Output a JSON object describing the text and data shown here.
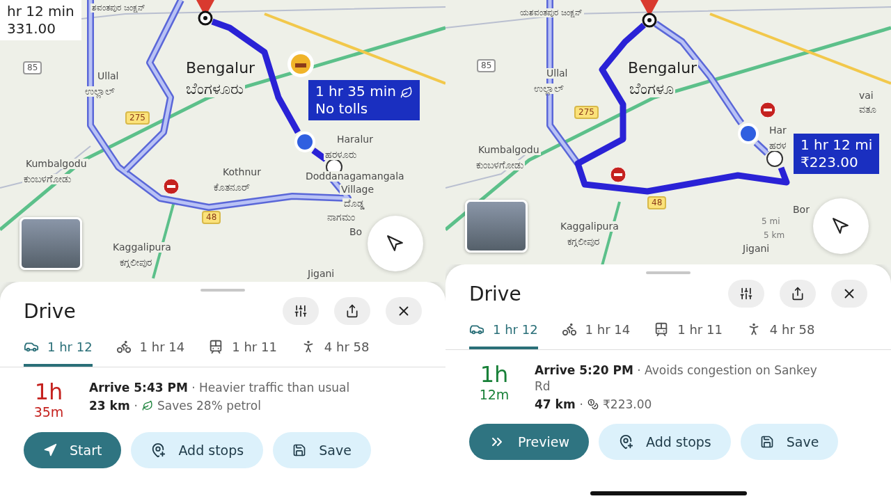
{
  "panels": [
    {
      "map": {
        "labels": [
          {
            "text": "ಶವಂತಪುರ ಜಂಕ್ಷನ್",
            "kind": "small"
          },
          {
            "text": "Bengalur",
            "kind": "city"
          },
          {
            "text": "ಬೆಂಗಳೂರು",
            "kind": "city"
          },
          {
            "text": "Ullal",
            "kind": "place"
          },
          {
            "text": "ಉಲ್ಲಾಲ್",
            "kind": "place"
          },
          {
            "text": "85",
            "kind": "shield-white"
          },
          {
            "text": "275",
            "kind": "shield"
          },
          {
            "text": "48",
            "kind": "shield"
          },
          {
            "text": "Kumbalgodu",
            "kind": "place"
          },
          {
            "text": "ಕುಂಬಳಗೋಡು",
            "kind": "place"
          },
          {
            "text": "Kothnur",
            "kind": "place"
          },
          {
            "text": "ಕೊತನೂರ್",
            "kind": "place"
          },
          {
            "text": "Haralur",
            "kind": "place"
          },
          {
            "text": "ಹರಳೂರು",
            "kind": "place"
          },
          {
            "text": "Doddanagamangala",
            "kind": "place"
          },
          {
            "text": "Village",
            "kind": "place"
          },
          {
            "text": "ದೊಡ್ಡ",
            "kind": "place"
          },
          {
            "text": "ನಾಗಮಂ",
            "kind": "place"
          },
          {
            "text": "Bo",
            "kind": "place"
          },
          {
            "text": "Kaggalipura",
            "kind": "place"
          },
          {
            "text": "ಕಗ್ಗಲೀಪುರ",
            "kind": "place"
          },
          {
            "text": "Jigani",
            "kind": "place"
          }
        ],
        "callouts": [
          {
            "lines": [
              "hr 12 min",
              "331.00"
            ],
            "selected": false,
            "eco": false
          },
          {
            "lines": [
              "1 hr 35 min",
              "No tolls"
            ],
            "selected": true,
            "eco": true
          }
        ]
      },
      "sheet": {
        "title": "Drive",
        "modes": [
          {
            "kind": "car",
            "label": "1 hr 12",
            "selected": true
          },
          {
            "kind": "bike",
            "label": "1 hr 14",
            "selected": false
          },
          {
            "kind": "transit",
            "label": "1 hr 11",
            "selected": false
          },
          {
            "kind": "walk",
            "label": "4 hr 58",
            "selected": false
          }
        ],
        "duration": [
          "1h",
          "35m"
        ],
        "heavy_traffic": true,
        "arrival": "**Arrive 5:43 PM** · Heavier traffic than usual",
        "distance": "23 km",
        "separator": "·",
        "detail": {
          "kind": "eco",
          "text": "Saves 28% petrol"
        },
        "buttons": [
          {
            "kind": "start",
            "label": "Start"
          },
          {
            "kind": "add-stop",
            "label": "Add stops"
          },
          {
            "kind": "save",
            "label": "Save"
          }
        ],
        "home_indicator": false
      }
    },
    {
      "map": {
        "labels": [
          {
            "text": "ಯಶವಂತಪುರ ಜಂಕ್ಷನ್",
            "kind": "small"
          },
          {
            "text": "Bengalur",
            "kind": "city"
          },
          {
            "text": "ಬೆಂಗಳೂ",
            "kind": "city"
          },
          {
            "text": "Ullal",
            "kind": "place"
          },
          {
            "text": "ಉಲ್ಲಾಲ್",
            "kind": "place"
          },
          {
            "text": "85",
            "kind": "shield-white"
          },
          {
            "text": "275",
            "kind": "shield"
          },
          {
            "text": "48",
            "kind": "shield"
          },
          {
            "text": "Kumbalgodu",
            "kind": "place"
          },
          {
            "text": "ಕುಂಬಳಗೋಡು",
            "kind": "place"
          },
          {
            "text": "Har",
            "kind": "place"
          },
          {
            "text": "ಹರಳ",
            "kind": "place"
          },
          {
            "text": "vai",
            "kind": "place"
          },
          {
            "text": "ವತೂ",
            "kind": "place"
          },
          {
            "text": "Bor",
            "kind": "place"
          },
          {
            "text": "5 mi",
            "kind": "scale"
          },
          {
            "text": "5 km",
            "kind": "scale"
          },
          {
            "text": "Kaggalipura",
            "kind": "place"
          },
          {
            "text": "ಕಗ್ಗಲೀಪುರ",
            "kind": "place"
          },
          {
            "text": "Jigani",
            "kind": "place"
          }
        ],
        "callouts": [
          {
            "lines": [
              "1 hr 12 mi",
              "₹223.00"
            ],
            "selected": true,
            "eco": false
          }
        ]
      },
      "sheet": {
        "title": "Drive",
        "modes": [
          {
            "kind": "car",
            "label": "1 hr 12",
            "selected": true
          },
          {
            "kind": "bike",
            "label": "1 hr 14",
            "selected": false
          },
          {
            "kind": "transit",
            "label": "1 hr 11",
            "selected": false
          },
          {
            "kind": "walk",
            "label": "4 hr 58",
            "selected": false
          }
        ],
        "duration": [
          "1h",
          "12m"
        ],
        "heavy_traffic": false,
        "arrival": "**Arrive 5:20 PM** · Avoids congestion on Sankey Rd",
        "distance": "47 km",
        "separator": "·",
        "detail": {
          "kind": "toll",
          "text": "₹223.00"
        },
        "buttons": [
          {
            "kind": "preview",
            "label": "Preview"
          },
          {
            "kind": "add-stop",
            "label": "Add stops"
          },
          {
            "kind": "save",
            "label": "Save"
          }
        ],
        "home_indicator": true
      }
    }
  ]
}
